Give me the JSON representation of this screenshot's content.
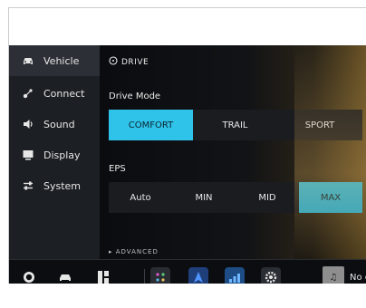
{
  "sidebar": {
    "items": [
      {
        "label": "Vehicle",
        "icon": "car-icon",
        "active": true
      },
      {
        "label": "Connect",
        "icon": "connect-icon",
        "active": false
      },
      {
        "label": "Sound",
        "icon": "speaker-icon",
        "active": false
      },
      {
        "label": "Display",
        "icon": "display-icon",
        "active": false
      },
      {
        "label": "System",
        "icon": "sliders-icon",
        "active": false
      }
    ]
  },
  "drive": {
    "section_title": "DRIVE",
    "drive_mode_label": "Drive Mode",
    "drive_modes": [
      "COMFORT",
      "TRAIL",
      "SPORT"
    ],
    "drive_mode_selected": "COMFORT",
    "eps_label": "EPS",
    "eps_options": [
      "Auto",
      "MIN",
      "MID",
      "MAX"
    ],
    "eps_selected": "MAX",
    "advanced_label": "ADVANCED"
  },
  "dock": {
    "media_text": "No c",
    "icons": [
      "steering-wheel-icon",
      "car-icon",
      "apps-grid-icon",
      "games-icon",
      "navigation-icon",
      "signal-bars-icon",
      "settings-gear-icon",
      "music-note-icon"
    ]
  },
  "colors": {
    "accent": "#2fc3ea",
    "sidebar_bg": "#1c1f23",
    "screen_bg": "#0d0f12"
  }
}
